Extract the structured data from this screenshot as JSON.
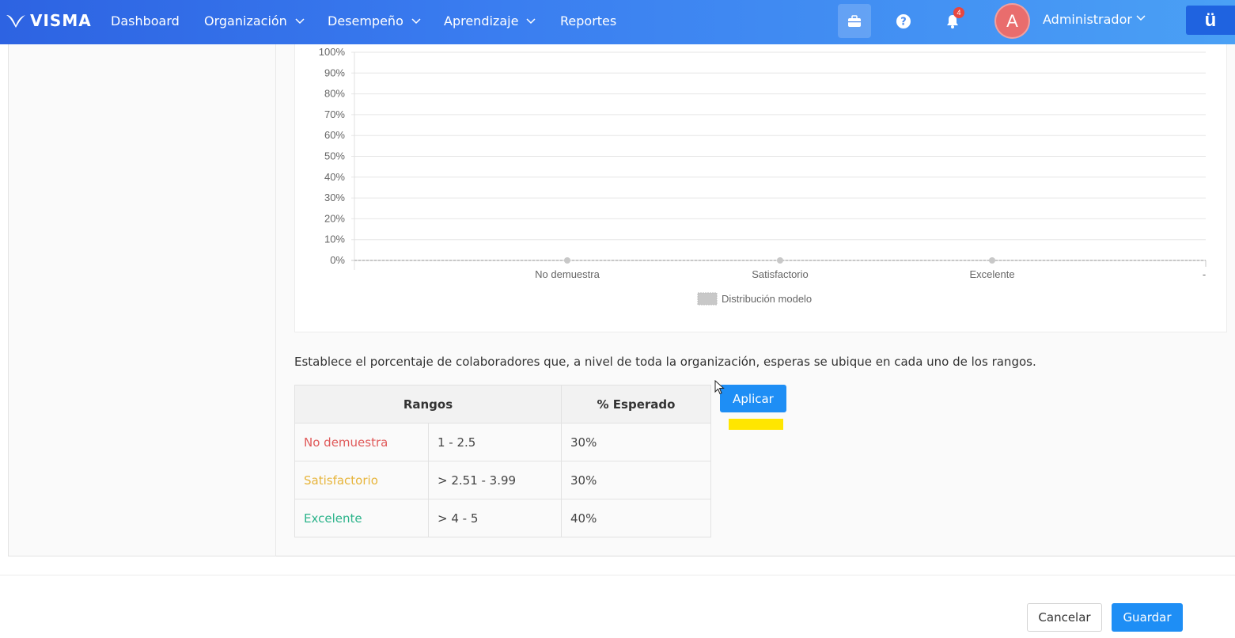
{
  "header": {
    "brand": "VISMA",
    "nav": [
      {
        "label": "Dashboard"
      },
      {
        "label": "Organización"
      },
      {
        "label": "Desempeño"
      },
      {
        "label": "Aprendizaje"
      },
      {
        "label": "Reportes"
      }
    ],
    "notifications_count": "4",
    "avatar_initial": "A",
    "user_name": "Administrador",
    "brand_badge": "ü"
  },
  "chart_data": {
    "type": "line",
    "categories": [
      "No demuestra",
      "Satisfactorio",
      "Excelente",
      "-"
    ],
    "series": [
      {
        "name": "Distribución modelo",
        "values": [
          0,
          0,
          0
        ]
      }
    ],
    "ytick_labels": [
      "100%",
      "90%",
      "80%",
      "70%",
      "60%",
      "50%",
      "40%",
      "30%",
      "20%",
      "10%",
      "0%"
    ],
    "ylim": [
      0,
      100
    ],
    "grid": true,
    "legend_position": "bottom",
    "series_color": "#c8c8c8"
  },
  "instruction": "Establece el porcentaje de colaboradores que, a nivel de toda la organización, esperas se ubique en cada uno de los rangos.",
  "table": {
    "headers": {
      "ranges": "Rangos",
      "expected": "% Esperado"
    },
    "rows": [
      {
        "label": "No demuestra",
        "range": "1 - 2.5",
        "expected": "30%",
        "color": "#e05a5a"
      },
      {
        "label": "Satisfactorio",
        "range": "> 2.51 - 3.99",
        "expected": "30%",
        "color": "#e7b53c"
      },
      {
        "label": "Excelente",
        "range": "> 4 - 5",
        "expected": "40%",
        "color": "#2bb38a"
      }
    ]
  },
  "apply_label": "Aplicar",
  "footer": {
    "cancel_label": "Cancelar",
    "save_label": "Guardar"
  }
}
